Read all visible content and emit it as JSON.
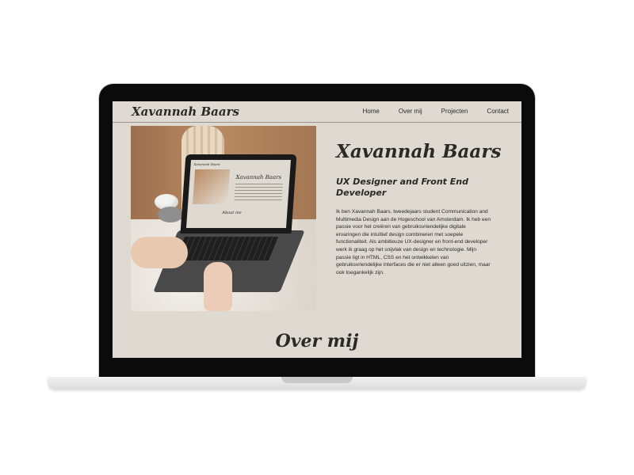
{
  "site": {
    "brand": "Xavannah Baars",
    "nav": [
      "Home",
      "Over mij",
      "Projecten",
      "Contact"
    ]
  },
  "hero": {
    "name": "Xavannah Baars",
    "role": "UX Designer and Front End Developer",
    "bio": "Ik ben Xavannah Baars, tweedejaars student Communication and Multimedia Design aan de Hogeschool van Amsterdam. Ik heb een passie voor het creëren van gebruiksvriendelijke digitale ervaringen die intuïtief design combineren met soepele functionaliteit. Als ambitieuze UX-designer en front-end developer werk ik graag op het snijvlak van design en technologie. Mijn passie ligt in HTML, CSS en het ontwikkelen van gebruiksvriendelijke interfaces die er niet alleen goed uitzien, maar ook toegankelijk zijn."
  },
  "photo": {
    "mini_brand": "Xavannah Baars",
    "mini_title": "Xavannah Baars",
    "mini_about": "About me"
  },
  "section": {
    "title": "Over mij"
  },
  "colors": {
    "background": "#dedad1",
    "text": "#2b2926",
    "frame": "#0b0b0b"
  }
}
